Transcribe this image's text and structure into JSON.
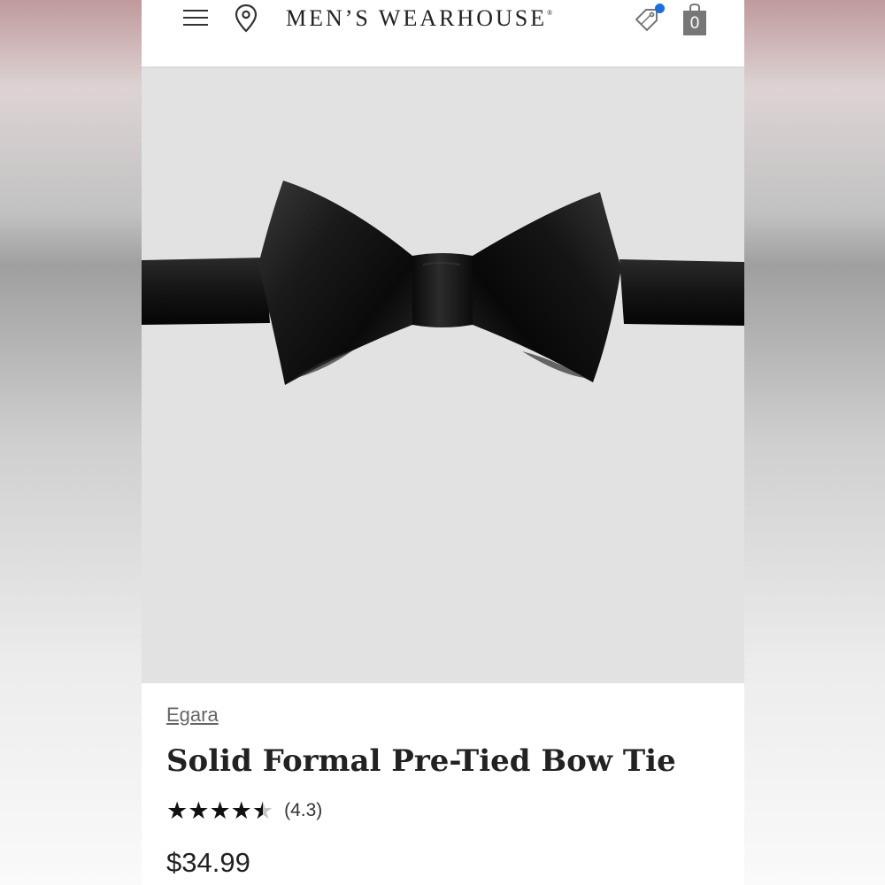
{
  "header": {
    "logo_text": "MEN’S WEARHOUSE",
    "logo_mark": "®",
    "menu_icon": "hamburger-menu-icon",
    "location_icon": "map-pin-icon",
    "offers_icon": "price-tag-icon",
    "cart_icon": "shopping-bag-icon",
    "cart_count": "0",
    "notification_dot_color": "#1a6fe0"
  },
  "product": {
    "image_alt_icon": "black-bow-tie-image",
    "brand": "Egara",
    "title": "Solid Formal Pre-Tied Bow Tie",
    "rating_value": 4.3,
    "rating_max": 5,
    "rating_text": "(4.3)",
    "price": "$34.99"
  },
  "colors": {
    "image_background": "#e2e2e2",
    "text_primary": "#222222",
    "brand_link": "#666666"
  }
}
